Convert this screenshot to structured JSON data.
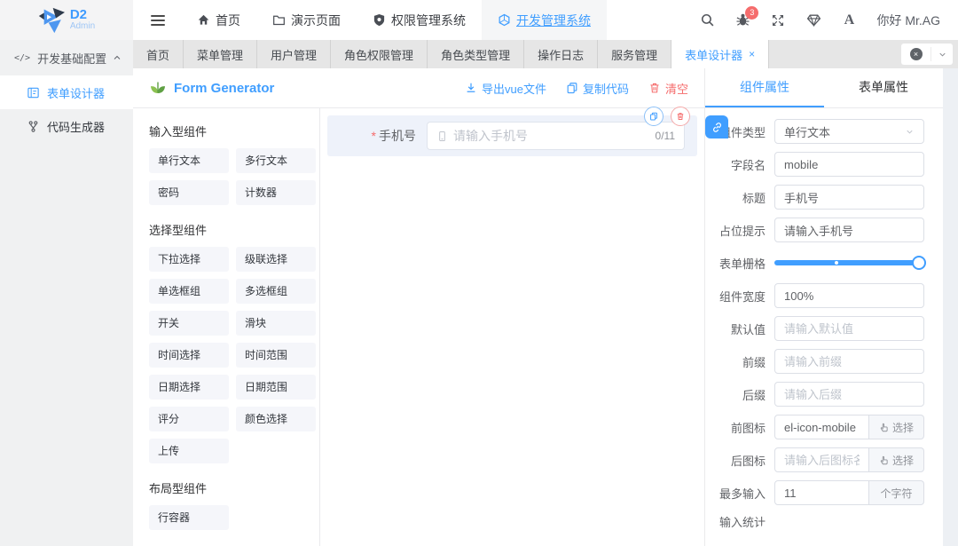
{
  "colors": {
    "accent": "#409EFF",
    "danger": "#F56C6C",
    "success": "#67C23A"
  },
  "icons": {
    "close": "×",
    "code": "</>"
  },
  "topbar": {
    "logo": {
      "title": "D2",
      "subtitle": "Admin"
    },
    "nav": [
      {
        "label": "首页"
      },
      {
        "label": "演示页面"
      },
      {
        "label": "权限管理系统"
      },
      {
        "label": "开发管理系统"
      }
    ],
    "badge_count": "3",
    "font_label": "A",
    "greeting": "你好 Mr.AG"
  },
  "sidebar": {
    "group_label": "开发基础配置",
    "items": [
      {
        "label": "表单设计器"
      },
      {
        "label": "代码生成器"
      }
    ]
  },
  "tabs": {
    "items": [
      "首页",
      "菜单管理",
      "用户管理",
      "角色权限管理",
      "角色类型管理",
      "操作日志",
      "服务管理",
      "表单设计器"
    ],
    "active": "表单设计器"
  },
  "generator": {
    "title": "Form Generator",
    "actions": {
      "export": "导出vue文件",
      "copy": "复制代码",
      "clear": "清空"
    }
  },
  "components_panel": {
    "sections": [
      {
        "title": "输入型组件",
        "items": [
          "单行文本",
          "多行文本",
          "密码",
          "计数器"
        ]
      },
      {
        "title": "选择型组件",
        "items": [
          "下拉选择",
          "级联选择",
          "单选框组",
          "多选框组",
          "开关",
          "滑块",
          "时间选择",
          "时间范围",
          "日期选择",
          "日期范围",
          "评分",
          "颜色选择",
          "上传"
        ]
      },
      {
        "title": "布局型组件",
        "items": [
          "行容器"
        ]
      }
    ]
  },
  "canvas": {
    "field": {
      "required_mark": "*",
      "label": "手机号",
      "placeholder": "请输入手机号",
      "counter": "0/11"
    }
  },
  "props": {
    "tabs": [
      {
        "label": "组件属性"
      },
      {
        "label": "表单属性"
      }
    ],
    "component_type": {
      "label": "组件类型",
      "value": "单行文本"
    },
    "field_name": {
      "label": "字段名",
      "value": "mobile"
    },
    "title": {
      "label": "标题",
      "value": "手机号"
    },
    "placeholder_field": {
      "label": "占位提示",
      "value": "请输入手机号"
    },
    "form_grid": {
      "label": "表单栅格"
    },
    "width": {
      "label": "组件宽度",
      "value": "100%"
    },
    "default_value": {
      "label": "默认值",
      "placeholder": "请输入默认值"
    },
    "prefix": {
      "label": "前缀",
      "placeholder": "请输入前缀"
    },
    "suffix": {
      "label": "后缀",
      "placeholder": "请输入后缀"
    },
    "prefix_icon": {
      "label": "前图标",
      "value": "el-icon-mobile",
      "button": "选择"
    },
    "suffix_icon": {
      "label": "后图标",
      "placeholder": "请输入后图标名称",
      "button": "选择"
    },
    "max_input": {
      "label": "最多输入",
      "value": "11",
      "unit": "个字符"
    },
    "input_stats": {
      "label": "输入统计"
    }
  }
}
